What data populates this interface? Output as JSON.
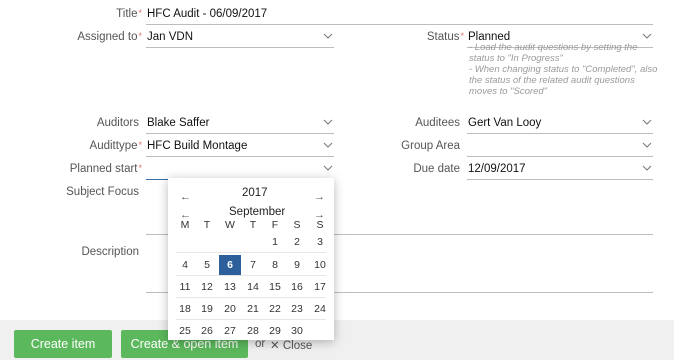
{
  "form": {
    "title_label": "Title",
    "title_value": "HFC Audit - 06/09/2017",
    "assigned_label": "Assigned to",
    "assigned_value": "Jan VDN",
    "status_label": "Status",
    "status_value": "Planned",
    "status_notes": [
      "- Load the audit questions by setting the status to \"In Progress\"",
      "- When changing status to \"Completed\", also the status of the related audit questions moves to \"Scored\""
    ],
    "auditors_label": "Auditors",
    "auditors_value": "Blake Saffer",
    "auditees_label": "Auditees",
    "auditees_value": "Gert Van Looy",
    "audittype_label": "Audittype",
    "audittype_value": "HFC Build Montage",
    "grouparea_label": "Group Area",
    "grouparea_value": "",
    "planned_start_label": "Planned start",
    "planned_start_value": "",
    "due_date_label": "Due date",
    "due_date_value": "12/09/2017",
    "subject_focus_label": "Subject Focus",
    "description_label": "Description",
    "required_mark": "*"
  },
  "calendar": {
    "year": "2017",
    "month": "September",
    "prev_arrow": "←",
    "next_arrow": "→",
    "weekdays": [
      "M",
      "T",
      "W",
      "T",
      "F",
      "S",
      "S"
    ],
    "weeks": [
      [
        "",
        "",
        "",
        "",
        "1",
        "2",
        "3"
      ],
      [
        "4",
        "5",
        "6",
        "7",
        "8",
        "9",
        "10"
      ],
      [
        "11",
        "12",
        "13",
        "14",
        "15",
        "16",
        "17"
      ],
      [
        "18",
        "19",
        "20",
        "21",
        "22",
        "23",
        "24"
      ],
      [
        "25",
        "26",
        "27",
        "28",
        "29",
        "30",
        ""
      ]
    ],
    "selected_day": "6"
  },
  "footer": {
    "create_label": "Create item",
    "or1": "or",
    "create_open_label": "Create & open item",
    "or2": "or",
    "close_label": "✕ Close"
  },
  "colors": {
    "button": "#5cb85c",
    "selected_day": "#2d5f9a",
    "required": "#e07070"
  },
  "icons": {
    "dropdown": "chevron-down-icon",
    "close": "close-icon"
  }
}
